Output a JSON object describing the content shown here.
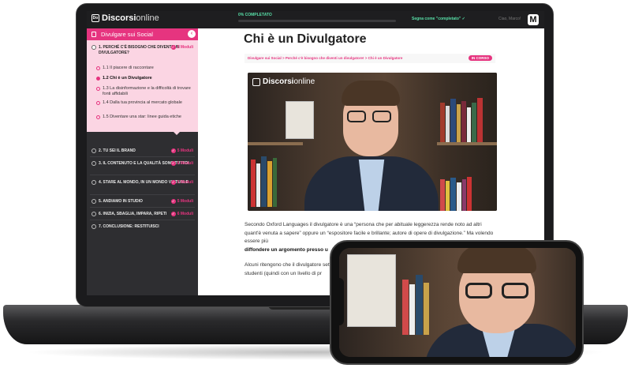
{
  "app": {
    "logo_bold": "Discorsi",
    "logo_light": "online",
    "logo_mark": "Do"
  },
  "topbar": {
    "progress_label": "0% COMPLETATO",
    "mark_complete": "Segna come \"completato\" ✓",
    "user_name": "Ciao, Marco!",
    "avatar_letter": "M"
  },
  "sidebar": {
    "course_title": "Divulgare sui Social",
    "open_module": {
      "title": "1. PERCHÉ C'È BISOGNO CHE DIVENTI UN DIVULGATORE?",
      "count": "5 Moduli",
      "lessons": [
        "1.1 Il piacere di raccontare",
        "1.2 Chi è un Divulgatore",
        "1.3 La disinformazione e la difficoltà di trovare fonti affidabili",
        "1.4 Dalla tua provincia al mercato globale",
        "1.5 Diventare una star: linee guida etiche"
      ]
    },
    "modules": [
      {
        "title": "2. TU SEI IL BRAND",
        "count": "5 Moduli"
      },
      {
        "title": "3. IL CONTENUTO E LA QUALITÀ SONO TUTTO!",
        "count": "6 Moduli"
      },
      {
        "title": "4. STARE AL MONDO, IN UN MONDO VIRTUALE",
        "count": "5 Moduli"
      },
      {
        "title": "5. ANDIAMO IN STUDIO",
        "count": "5 Moduli"
      },
      {
        "title": "6. INIZIA, SBAGLIA, IMPARA, RIPETI",
        "count": "6 Moduli"
      },
      {
        "title": "7. CONCLUSIONE: RESTITUISCI",
        "count": ""
      }
    ]
  },
  "main": {
    "page_title": "Chi è un Divulgatore",
    "breadcrumb": "Divulgare sui Social > Perché c'è bisogno che diventi un divulgatore! > Chi è un Divulgatore",
    "status": "IN CORSO",
    "video_logo_bold": "Discorsi",
    "video_logo_light": "online",
    "para1_a": "Secondo Oxford Languages il divulgatore è una “persona che per abituale leggerezza rende noto ad altri quant'è venuta a sapere” oppure un “espositore facile e brillante; autore di opere di divulgazione.” Ma volendo essere più",
    "para1_b": "diffondere un argomento presso u",
    "para2": "Alcuni ritengono che il divulgatore settore, altamente titolato e aggio esperto. Un esempio potrebbe ess studenti (quindi con un livello di pr"
  }
}
